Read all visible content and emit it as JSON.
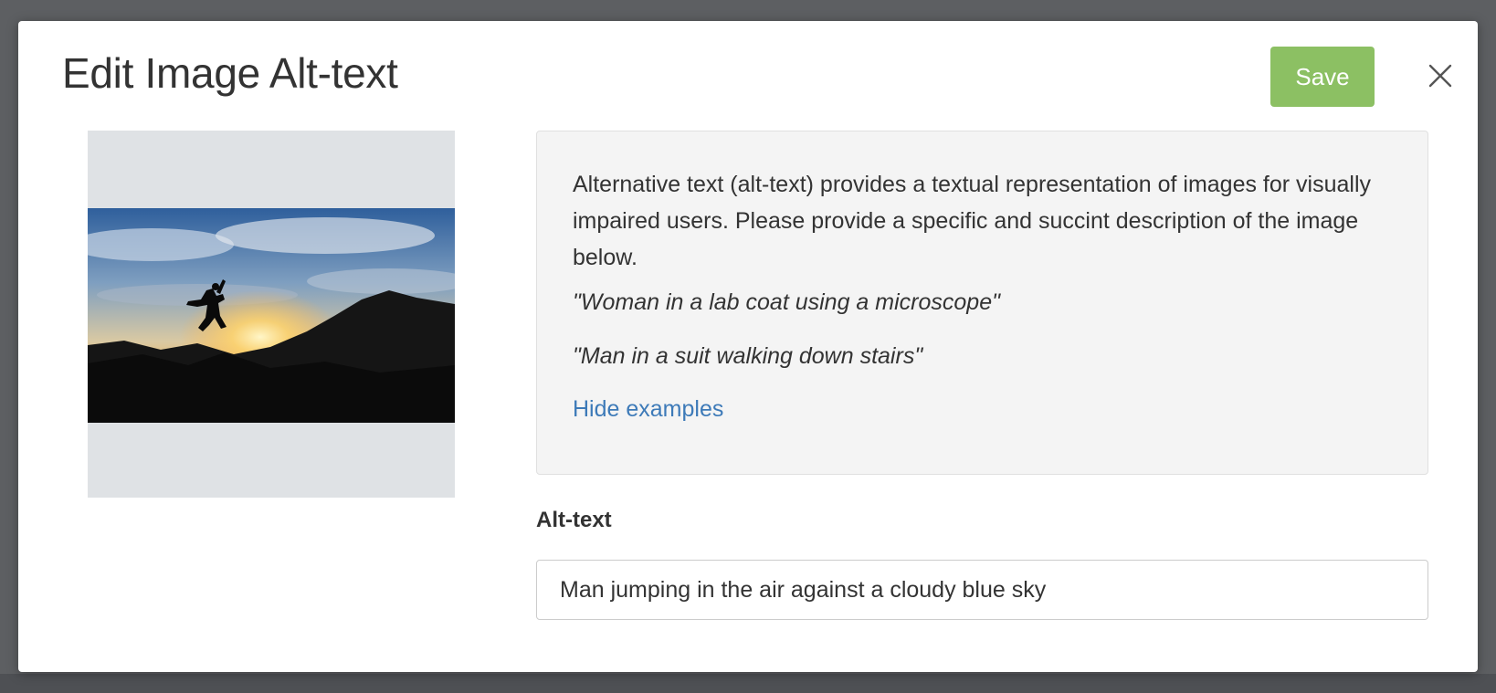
{
  "dialog": {
    "title": "Edit Image Alt-text",
    "save_label": "Save",
    "close_icon": "close-icon"
  },
  "preview": {
    "image": "silhouette-jumping-sunset-photo"
  },
  "info": {
    "description": "Alternative text (alt-text) provides a textual representation of images for visually impaired users. Please provide a specific and succint description of the image below.",
    "examples": [
      "\"Woman in a lab coat using a microscope\"",
      "\"Man in a suit walking down stairs\""
    ],
    "toggle_label": "Hide examples"
  },
  "alt_text": {
    "label": "Alt-text",
    "value": "Man jumping in the air against a cloudy blue sky"
  },
  "colors": {
    "save_button": "#8cc063",
    "link": "#3d7ab8",
    "info_background": "#f4f4f4",
    "backdrop": "#5d5f62"
  }
}
